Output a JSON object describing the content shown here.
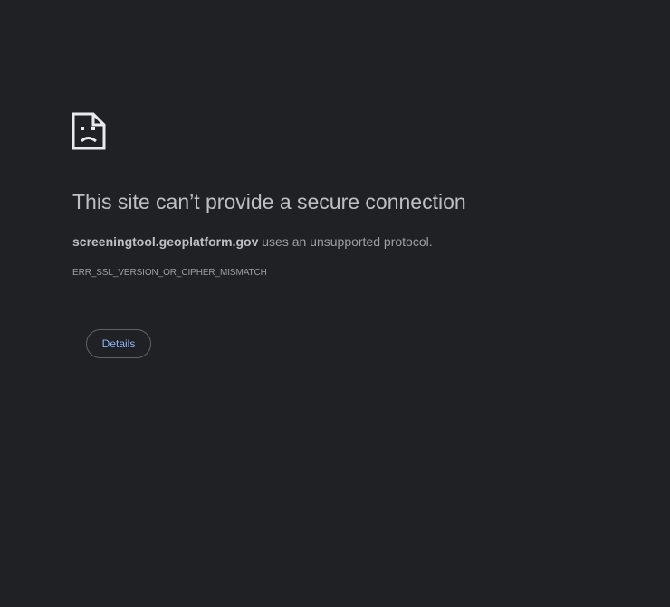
{
  "error": {
    "icon": "sad-page-icon",
    "title": "This site can’t provide a secure connection",
    "host": "screeningtool.geoplatform.gov",
    "message_suffix": " uses an unsupported protocol.",
    "code": "ERR_SSL_VERSION_OR_CIPHER_MISMATCH",
    "details_label": "Details"
  },
  "colors": {
    "background": "#202124",
    "title": "#bdc1c6",
    "text": "#9aa0a6",
    "link": "#8ab4f8",
    "button_border": "#5f6368"
  }
}
